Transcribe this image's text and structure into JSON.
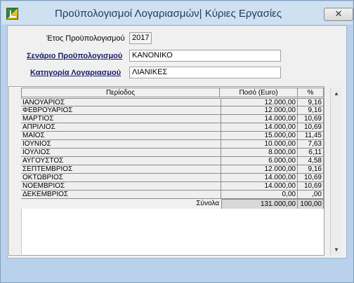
{
  "window": {
    "title": "Προϋπολογισμοί Λογαριασμών| Κύριες Εργασίες",
    "close_label": "✕"
  },
  "form": {
    "year_label": "Έτος Προϋπολογισμού",
    "year_value": "2017",
    "scenario_label": "Σενάριο Προϋπολογισμού",
    "scenario_value": "ΚΑΝΟΝΙΚΟ",
    "category_label": "Κατηγορία Λογαριασμού",
    "category_value": "ΛΙΑΝΙΚΕΣ"
  },
  "table": {
    "headers": {
      "period": "Περίοδος",
      "amount": "Ποσό (Euro)",
      "pct": "%"
    },
    "rows": [
      {
        "period": "ΙΑΝΟΥΑΡΙΟΣ",
        "amount": "12.000,00",
        "pct": "9,16"
      },
      {
        "period": "ΦΕΒΡΟΥΑΡΙΟΣ",
        "amount": "12.000,00",
        "pct": "9,16"
      },
      {
        "period": "ΜΑΡΤΙΟΣ",
        "amount": "14.000,00",
        "pct": "10,69"
      },
      {
        "period": "ΑΠΡΙΛΙΟΣ",
        "amount": "14.000,00",
        "pct": "10,69"
      },
      {
        "period": "ΜΑΪΟΣ",
        "amount": "15.000,00",
        "pct": "11,45"
      },
      {
        "period": "ΙΟΥΝΙΟΣ",
        "amount": "10.000,00",
        "pct": "7,63"
      },
      {
        "period": "ΙΟΥΛΙΟΣ",
        "amount": "8.000,00",
        "pct": "6,11"
      },
      {
        "period": "ΑΥΓΟΥΣΤΟΣ",
        "amount": "6.000,00",
        "pct": "4,58"
      },
      {
        "period": "ΣΕΠΤΕΜΒΡΙΟΣ",
        "amount": "12.000,00",
        "pct": "9,16"
      },
      {
        "period": "ΟΚΤΩΒΡΙΟΣ",
        "amount": "14.000,00",
        "pct": "10,69"
      },
      {
        "period": "ΝΟΕΜΒΡΙΟΣ",
        "amount": "14.000,00",
        "pct": "10,69"
      },
      {
        "period": "ΔΕΚΕΜΒΡΙΟΣ",
        "amount": "0,00",
        "pct": ",00"
      }
    ],
    "footer": {
      "label": "Σύνολα",
      "amount": "131.000,00",
      "pct": "100,00"
    }
  },
  "scrollbar": {
    "up_icon": "▲",
    "down_icon": "▼"
  }
}
